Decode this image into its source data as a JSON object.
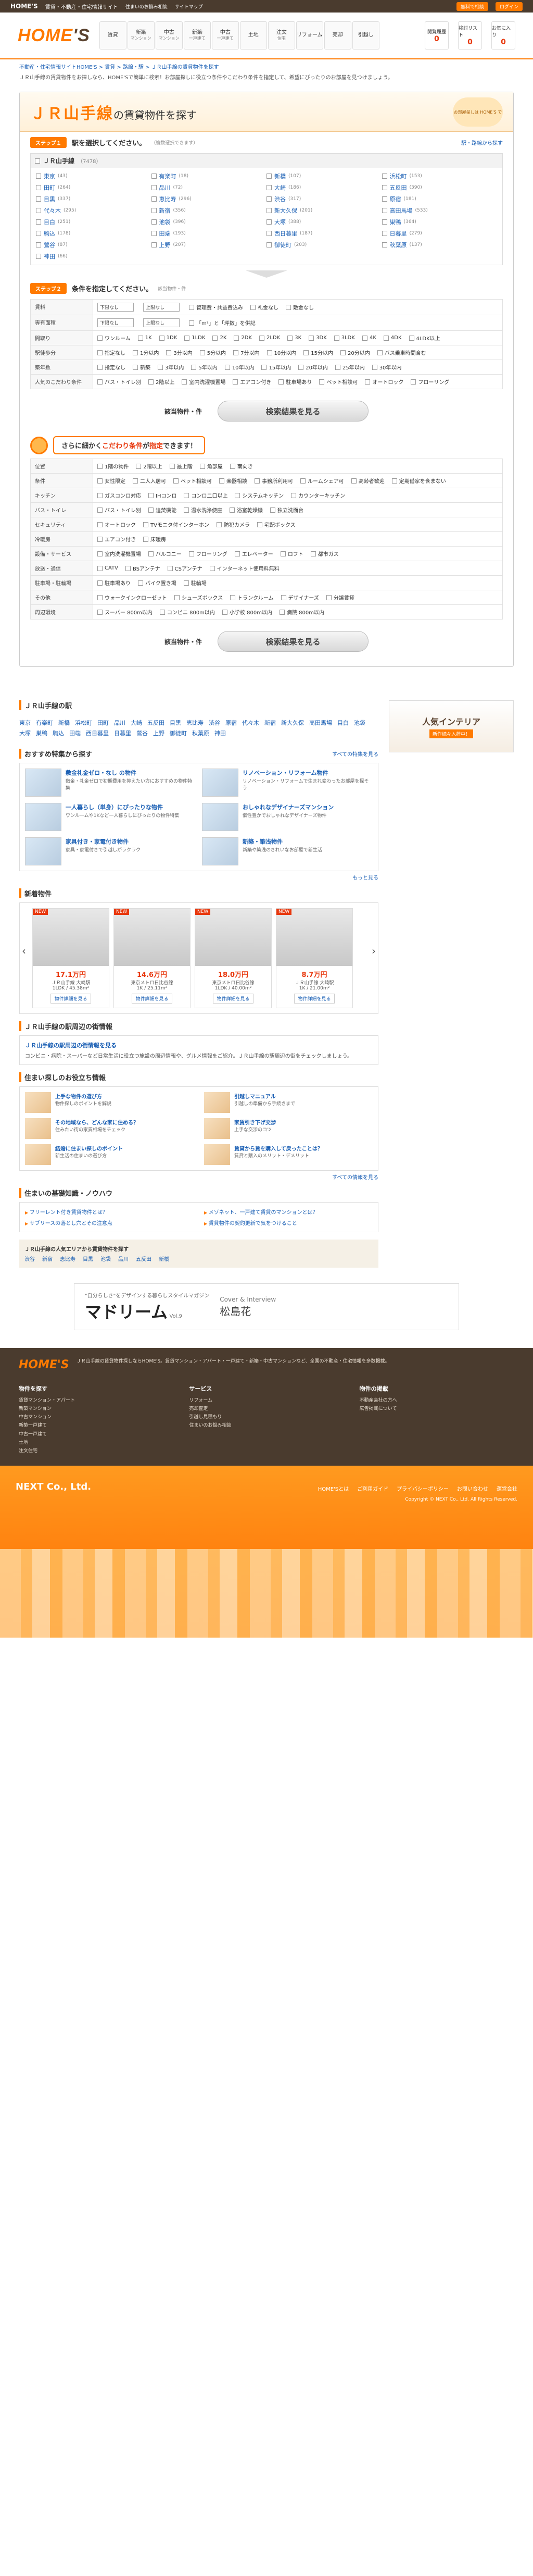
{
  "topbar": {
    "brand": "HOME'S",
    "tagline": "賃貸・不動産・住宅情報サイト",
    "pill1": "無料で相談",
    "pill2": "ログイン",
    "links": [
      "住まいのお悩み相談",
      "サイトマップ"
    ]
  },
  "header": {
    "logo_main": "HOME",
    "logo_tail": "'S",
    "nav": [
      {
        "label": "賃貸",
        "sub": ""
      },
      {
        "label": "新築",
        "sub": "マンション"
      },
      {
        "label": "中古",
        "sub": "マンション"
      },
      {
        "label": "新築",
        "sub": "一戸建て"
      },
      {
        "label": "中古",
        "sub": "一戸建て"
      },
      {
        "label": "土地",
        "sub": ""
      },
      {
        "label": "注文",
        "sub": "住宅"
      },
      {
        "label": "リフォーム",
        "sub": ""
      },
      {
        "label": "売却",
        "sub": ""
      },
      {
        "label": "引越し",
        "sub": ""
      }
    ],
    "icons": [
      {
        "label": "閲覧履歴",
        "count": "0"
      },
      {
        "label": "検討リスト",
        "count": "0"
      },
      {
        "label": "お気に入り",
        "count": "0"
      }
    ]
  },
  "breadcrumb": "不動産・住宅情報サイトHOME'S > 賃貸 > 路線・駅 > ＪＲ山手線の賃貸物件を探す",
  "intro_text": "ＪＲ山手線の賃貸物件をお探しなら、HOME'Sで簡単に検索！お部屋探しに役立つ条件やこだわり条件を指定して、希望にぴったりのお部屋を見つけましょう。",
  "panel": {
    "title": "ＪＲ山手線",
    "title_sub": "の賃貸物件を探す",
    "badge": "お部屋探しは HOME'S で",
    "step1_tag": "ステップ１",
    "step1_title": "駅を選択してください。",
    "step1_note": "（複数選択できます）",
    "step1_link": "駅・路線から探す",
    "line_name": "ＪＲ山手線",
    "line_count": "（7478）",
    "stations": [
      {
        "name": "東京",
        "n": "(43)"
      },
      {
        "name": "有楽町",
        "n": "(18)"
      },
      {
        "name": "新橋",
        "n": "(107)"
      },
      {
        "name": "浜松町",
        "n": "(153)"
      },
      {
        "name": "田町",
        "n": "(264)"
      },
      {
        "name": "品川",
        "n": "(72)"
      },
      {
        "name": "大崎",
        "n": "(186)"
      },
      {
        "name": "五反田",
        "n": "(390)"
      },
      {
        "name": "目黒",
        "n": "(337)"
      },
      {
        "name": "恵比寿",
        "n": "(296)"
      },
      {
        "name": "渋谷",
        "n": "(317)"
      },
      {
        "name": "原宿",
        "n": "(181)"
      },
      {
        "name": "代々木",
        "n": "(295)"
      },
      {
        "name": "新宿",
        "n": "(356)"
      },
      {
        "name": "新大久保",
        "n": "(201)"
      },
      {
        "name": "高田馬場",
        "n": "(533)"
      },
      {
        "name": "目白",
        "n": "(251)"
      },
      {
        "name": "池袋",
        "n": "(396)"
      },
      {
        "name": "大塚",
        "n": "(388)"
      },
      {
        "name": "巣鴨",
        "n": "(364)"
      },
      {
        "name": "駒込",
        "n": "(178)"
      },
      {
        "name": "田端",
        "n": "(193)"
      },
      {
        "name": "西日暮里",
        "n": "(187)"
      },
      {
        "name": "日暮里",
        "n": "(279)"
      },
      {
        "name": "鶯谷",
        "n": "(87)"
      },
      {
        "name": "上野",
        "n": "(207)"
      },
      {
        "name": "御徒町",
        "n": "(203)"
      },
      {
        "name": "秋葉原",
        "n": "(137)"
      },
      {
        "name": "神田",
        "n": "(66)"
      }
    ],
    "step2_tag": "ステップ２",
    "step2_title": "条件を指定してください。",
    "step2_count": "該当物件・件",
    "conditions": [
      {
        "label": "賃料",
        "selects": [
          "下限なし",
          "上限なし"
        ],
        "opts": [
          "管理費・共益費込み",
          "礼金なし",
          "敷金なし"
        ]
      },
      {
        "label": "専有面積",
        "selects": [
          "下限なし",
          "上限なし"
        ],
        "opts": [
          "「m²」と「坪数」を併記"
        ]
      },
      {
        "label": "間取り",
        "selects": [],
        "opts": [
          "ワンルーム",
          "1K",
          "1DK",
          "1LDK",
          "2K",
          "2DK",
          "2LDK",
          "3K",
          "3DK",
          "3LDK",
          "4K",
          "4DK",
          "4LDK以上"
        ]
      },
      {
        "label": "駅徒歩分",
        "selects": [],
        "opts": [
          "指定なし",
          "1分以内",
          "3分以内",
          "5分以内",
          "7分以内",
          "10分以内",
          "15分以内",
          "20分以内",
          "バス乗車時間含む"
        ]
      },
      {
        "label": "築年数",
        "selects": [],
        "opts": [
          "指定なし",
          "新築",
          "3年以内",
          "5年以内",
          "10年以内",
          "15年以内",
          "20年以内",
          "25年以内",
          "30年以内"
        ]
      },
      {
        "label": "人気のこだわり条件",
        "selects": [],
        "opts": [
          "バス・トイレ別",
          "2階以上",
          "室内洗濯機置場",
          "エアコン付き",
          "駐車場あり",
          "ペット相談可",
          "オートロック",
          "フローリング"
        ]
      }
    ],
    "result_count": "該当物件・件",
    "search_btn": "検索結果を見る",
    "extra_title_pre": "さらに細かく",
    "extra_title_em1": "こだわり条件",
    "extra_title_mid": "が",
    "extra_title_em2": "指定",
    "extra_title_post": "できます！",
    "extra_conditions": [
      {
        "label": "位置",
        "opts": [
          "1階の物件",
          "2階以上",
          "最上階",
          "角部屋",
          "南向き"
        ]
      },
      {
        "label": "条件",
        "opts": [
          "女性限定",
          "二人入居可",
          "ペット相談可",
          "楽器相談",
          "事務所利用可",
          "ルームシェア可",
          "高齢者歓迎",
          "定期借家を含まない"
        ]
      },
      {
        "label": "キッチン",
        "opts": [
          "ガスコンロ対応",
          "IHコンロ",
          "コンロ二口以上",
          "システムキッチン",
          "カウンターキッチン"
        ]
      },
      {
        "label": "バス・トイレ",
        "opts": [
          "バス・トイレ別",
          "追焚機能",
          "温水洗浄便座",
          "浴室乾燥機",
          "独立洗面台"
        ]
      },
      {
        "label": "セキュリティ",
        "opts": [
          "オートロック",
          "TVモニタ付インターホン",
          "防犯カメラ",
          "宅配ボックス"
        ]
      },
      {
        "label": "冷暖房",
        "opts": [
          "エアコン付き",
          "床暖房"
        ]
      },
      {
        "label": "設備・サービス",
        "opts": [
          "室内洗濯機置場",
          "バルコニー",
          "フローリング",
          "エレベーター",
          "ロフト",
          "都市ガス"
        ]
      },
      {
        "label": "放送・通信",
        "opts": [
          "CATV",
          "BSアンテナ",
          "CSアンテナ",
          "インターネット使用料無料"
        ]
      },
      {
        "label": "駐車場・駐輪場",
        "opts": [
          "駐車場あり",
          "バイク置き場",
          "駐輪場"
        ]
      },
      {
        "label": "その他",
        "opts": [
          "ウォークインクローゼット",
          "シューズボックス",
          "トランクルーム",
          "デザイナーズ",
          "分譲賃貸"
        ]
      },
      {
        "label": "周辺環境",
        "opts": [
          "スーパー 800m以内",
          "コンビニ 800m以内",
          "小学校 800m以内",
          "病院 800m以内"
        ]
      }
    ]
  },
  "lower": {
    "stations_title": "ＪＲ山手線の駅",
    "station_links": [
      "東京",
      "有楽町",
      "新橋",
      "浜松町",
      "田町",
      "品川",
      "大崎",
      "五反田",
      "目黒",
      "恵比寿",
      "渋谷",
      "原宿",
      "代々木",
      "新宿",
      "新大久保",
      "高田馬場",
      "目白",
      "池袋",
      "大塚",
      "巣鴨",
      "駒込",
      "田端",
      "西日暮里",
      "日暮里",
      "鶯谷",
      "上野",
      "御徒町",
      "秋葉原",
      "神田"
    ],
    "feature_title": "おすすめ特集から探す",
    "feature_more": "すべての特集を見る",
    "features": [
      {
        "title": "敷金礼金ゼロ・なし の物件",
        "desc": "敷金・礼金ゼロで初期費用を抑えたい方におすすめの物件特集"
      },
      {
        "title": "リノベーション・リフォーム物件",
        "desc": "リノベーション・リフォームで生まれ変わったお部屋を探そう"
      },
      {
        "title": "一人暮らし（単身）にぴったりな物件",
        "desc": "ワンルームや1Kなど一人暮らしにぴったりの物件特集"
      },
      {
        "title": "おしゃれなデザイナーズマンション",
        "desc": "個性豊かでおしゃれなデザイナーズ物件"
      },
      {
        "title": "家具付き・家電付き物件",
        "desc": "家具・家電付きで引越しがラクラク"
      },
      {
        "title": "新築・築浅物件",
        "desc": "新築や築浅のきれいなお部屋で新生活"
      }
    ],
    "feature_more2": "もっと見る",
    "new_title": "新着物件",
    "new_items": [
      {
        "tag": "NEW",
        "price": "17.1万円",
        "line1": "ＪＲ山手線 大崎駅",
        "line2": "1LDK / 45.38m²",
        "btn": "物件詳細を見る"
      },
      {
        "tag": "NEW",
        "price": "14.6万円",
        "line1": "東京メトロ日比谷線",
        "line2": "1K / 25.11m²",
        "btn": "物件詳細を見る"
      },
      {
        "tag": "NEW",
        "price": "18.0万円",
        "line1": "東京メトロ日比谷線",
        "line2": "1LDK / 40.00m²",
        "btn": "物件詳細を見る"
      },
      {
        "tag": "NEW",
        "price": "8.7万円",
        "line1": "ＪＲ山手線 大崎駅",
        "line2": "1K / 21.00m²",
        "btn": "物件詳細を見る"
      }
    ],
    "market_title": "ＪＲ山手線の駅周辺の街情報",
    "market_link": "ＪＲ山手線の駅周辺の街情報を見る",
    "market_text": "コンビニ・病院・スーパーなど日常生活に役立つ施設の周辺情報や、グルメ情報をご紹介。ＪＲ山手線の駅周辺の街をチェックしましょう。",
    "news_title": "住まい探しのお役立ち情報",
    "news": [
      {
        "title": "上手な物件の選び方",
        "desc": "物件探しのポイントを解説"
      },
      {
        "title": "引越しマニュアル",
        "desc": "引越しの準備から手続きまで"
      },
      {
        "title": "その地域なら、どんな家に住める？",
        "desc": "住みたい街の家賃相場をチェック"
      },
      {
        "title": "家賃引き下げ交渉",
        "desc": "上手な交渉のコツ"
      },
      {
        "title": "結婚に住まい探しのポイント",
        "desc": "新生活の住まいの選び方"
      },
      {
        "title": "賃貸から賃を購入して戻ったことは？",
        "desc": "賃貸と購入のメリット・デメリット"
      }
    ],
    "news_more": "すべての情報を見る",
    "faq_title": "住まいの基礎知識・ノウハウ",
    "faq": [
      "フリーレント付き賃貸物件とは？",
      "メゾネット、一戸建て賃貸のマンションとは？",
      "サブリースの落とし穴とその注意点",
      "賃貸物件の契約更新で気をつけること"
    ],
    "popular_title": "ＪＲ山手線の人気エリアから賃貸物件を探す",
    "popular_links": [
      "渋谷",
      "新宿",
      "恵比寿",
      "目黒",
      "池袋",
      "品川",
      "五反田",
      "新橋"
    ],
    "side_banner_title": "人気インテリア",
    "side_banner_sub": "新作続々入荷中！",
    "ad_pre": "\"自分らしさ\"をデザインする暮らしスタイルマガジン",
    "ad_title": "マドリーム",
    "ad_vol": "Vol.9",
    "ad_cover": "Cover & Interview",
    "ad_name": "松島花"
  },
  "footer": {
    "logo": "HOME'S",
    "desc": "ＪＲ山手線の賃貸物件探しならHOME'S。賃貸マンション・アパート・一戸建て・新築・中古マンションなど、全国の不動産・住宅情報を多数掲載。",
    "col1_title": "物件を探す",
    "col1_items": [
      "賃貸マンション・アパート",
      "新築マンション",
      "中古マンション",
      "新築一戸建て",
      "中古一戸建て",
      "土地",
      "注文住宅"
    ],
    "col2_title": "サービス",
    "col2_items": [
      "リフォーム",
      "売却査定",
      "引越し見積もり",
      "住まいのお悩み相談"
    ],
    "col3_title": "物件の掲載",
    "col3_items": [
      "不動産会社の方へ",
      "広告掲載について"
    ],
    "company": "NEXT Co., Ltd.",
    "foot_links": [
      "HOME'Sとは",
      "ご利用ガイド",
      "プライバシーポリシー",
      "お問い合わせ",
      "運営会社"
    ],
    "copyright": "Copyright © NEXT Co., Ltd. All Rights Reserved."
  }
}
